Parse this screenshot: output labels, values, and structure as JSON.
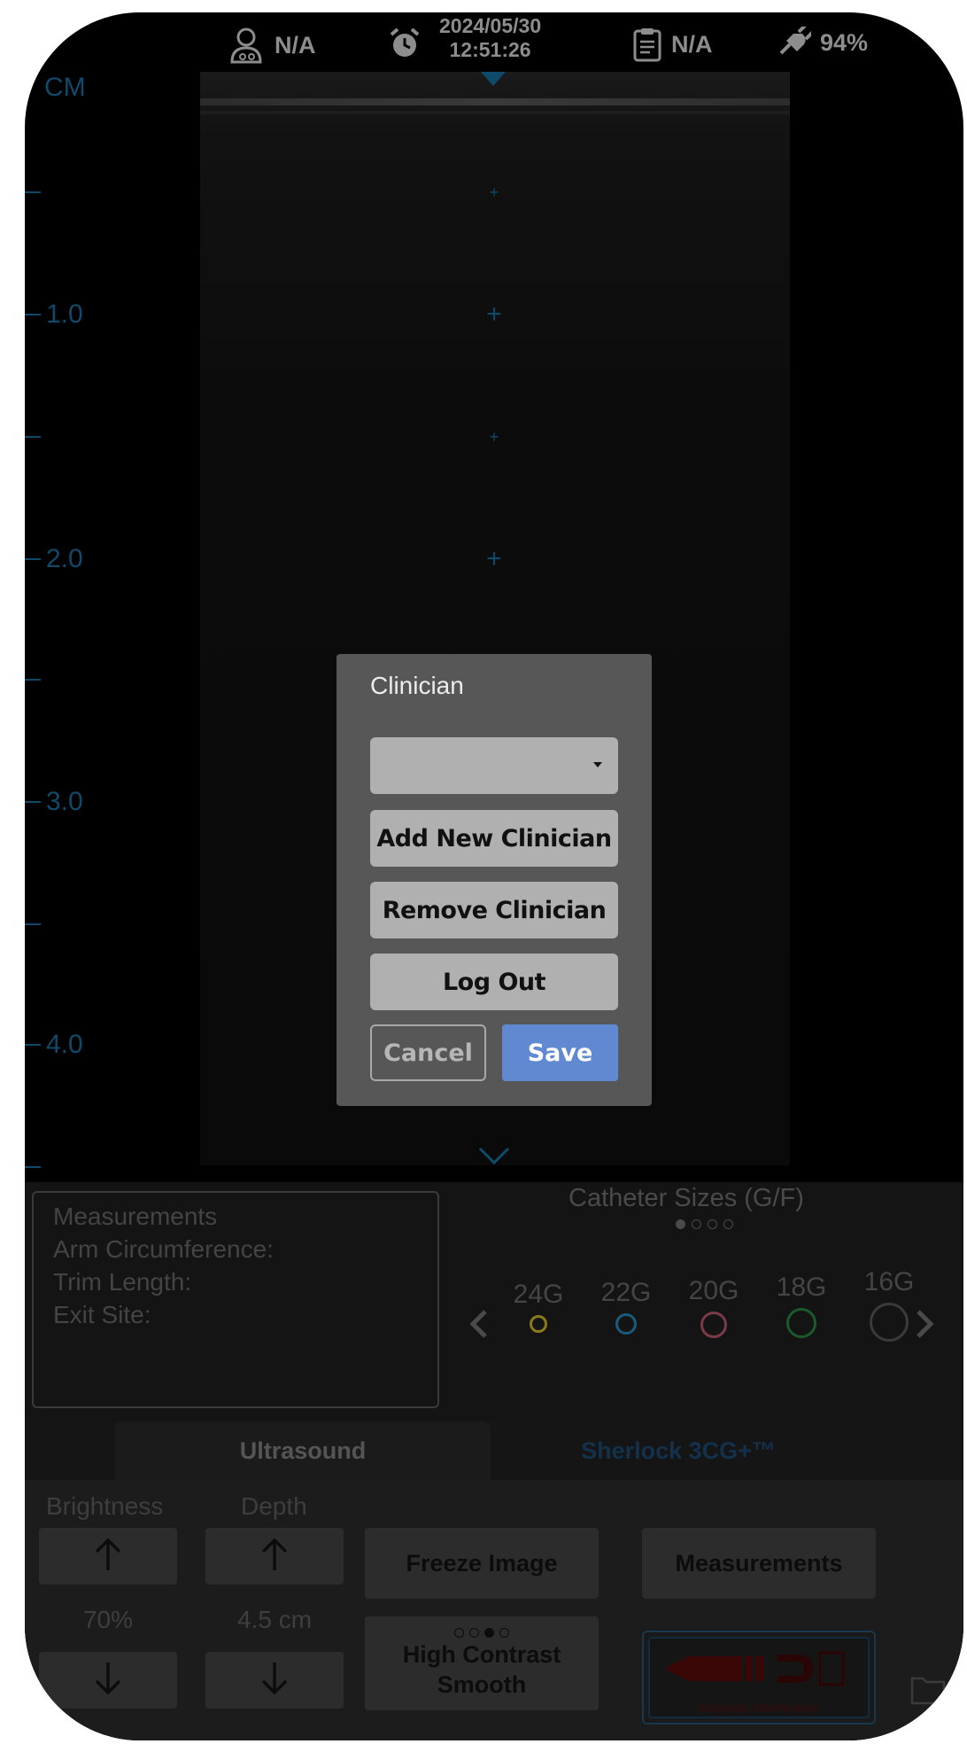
{
  "status_bar": {
    "clinician": "N/A",
    "date": "2024/05/30",
    "time": "12:51:26",
    "patient": "N/A",
    "battery": "94%"
  },
  "ultrasound": {
    "unit_label": "CM",
    "depth_marks": [
      "1.0",
      "2.0",
      "3.0",
      "4.0"
    ]
  },
  "measurements_box": {
    "title": "Measurements",
    "lines": [
      "Arm Circumference:",
      "Trim Length:",
      "Exit Site:"
    ]
  },
  "catheter": {
    "title": "Catheter Sizes (G/F)",
    "page_dots": 4,
    "active_page": 0,
    "gauges": [
      {
        "label": "24G",
        "color": "#8a7a1a"
      },
      {
        "label": "22G",
        "color": "#1a5a7a"
      },
      {
        "label": "20G",
        "color": "#7a3a4a"
      },
      {
        "label": "18G",
        "color": "#1a5a2a"
      },
      {
        "label": "16G",
        "color": "#3a3a3a"
      }
    ]
  },
  "tabs": {
    "ultrasound": "Ultrasound",
    "sherlock": "Sherlock 3CG+™"
  },
  "controls": {
    "brightness_label": "Brightness",
    "brightness_value": "70%",
    "depth_label": "Depth",
    "depth_value": "4.5 cm",
    "freeze_label": "Freeze Image",
    "measurements_label": "Measurements",
    "contrast_line1": "High Contrast",
    "contrast_line2": "Smooth",
    "contrast_mode_index": 2,
    "magnet_label": "Magnetic Interference"
  },
  "modal": {
    "title": "Clinician",
    "dropdown_value": "",
    "add_label": "Add New Clinician",
    "remove_label": "Remove Clinician",
    "logout_label": "Log Out",
    "cancel_label": "Cancel",
    "save_label": "Save"
  }
}
